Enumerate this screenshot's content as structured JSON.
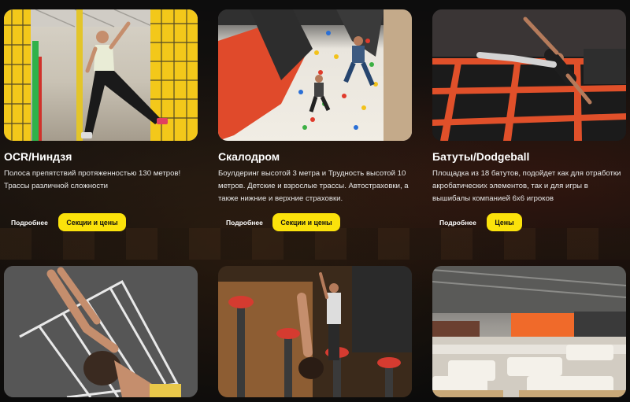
{
  "cards": [
    {
      "title": "OCR/Ниндзя",
      "desc_lines": [
        "Полоса препятствий протяженностью 130 метров!",
        "Трассы различной сложности"
      ],
      "more_label": "Подробнее",
      "cta_label": "Секции и цены"
    },
    {
      "title": "Скалодром",
      "desc_lines": [
        "Боулдеринг высотой 3 метра и Трудность высотой 10",
        "метров. Детские и взрослые трассы. Автостраховки, а",
        "также нижние и верхние страховки."
      ],
      "more_label": "Подробнее",
      "cta_label": "Секции и цены"
    },
    {
      "title": "Батуты/Dodgeball",
      "desc_lines": [
        "Площадка из 18 батутов, подойдет как для отработки",
        "акробатических элементов, так и для игры в",
        "вышибалы компанией 6х6 игроков"
      ],
      "more_label": "Подробнее",
      "cta_label": "Цены"
    }
  ],
  "colors": {
    "accent": "#fbe20b",
    "text": "#ffffff"
  }
}
